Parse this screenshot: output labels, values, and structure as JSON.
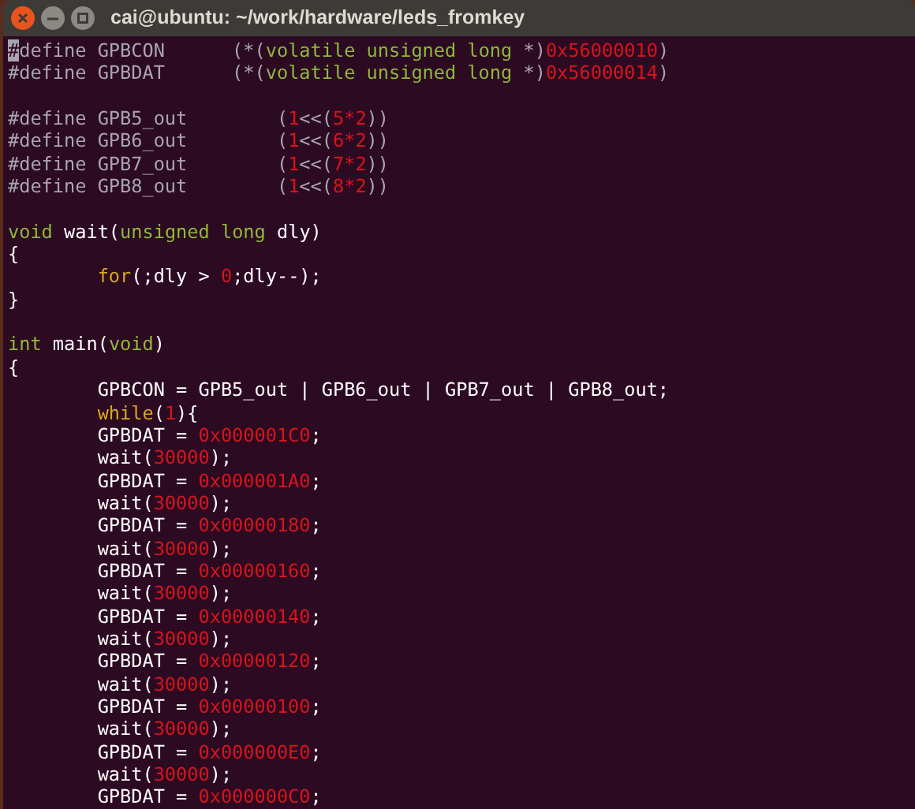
{
  "window": {
    "title": "cai@ubuntu: ~/work/hardware/leds_fromkey"
  },
  "blocks": [
    {
      "lines": [
        {
          "indented": false,
          "segments": [
            {
              "kind": "cursor",
              "text": "#"
            },
            {
              "kind": "preproc",
              "text": "define GPBCON      (*("
            },
            {
              "kind": "type",
              "text": "volatile unsigned long"
            },
            {
              "kind": "preproc",
              "text": " *)"
            },
            {
              "kind": "number",
              "text": "0x56000010"
            },
            {
              "kind": "preproc",
              "text": ")"
            }
          ]
        },
        {
          "indented": false,
          "segments": [
            {
              "kind": "preproc",
              "text": "#define GPBDAT      (*("
            },
            {
              "kind": "type",
              "text": "volatile unsigned long"
            },
            {
              "kind": "preproc",
              "text": " *)"
            },
            {
              "kind": "number",
              "text": "0x56000014"
            },
            {
              "kind": "preproc",
              "text": ")"
            }
          ]
        }
      ]
    },
    {
      "lines": [
        {
          "indented": false,
          "segments": [
            {
              "kind": "preproc",
              "text": "#define GPB5_out        ("
            },
            {
              "kind": "number",
              "text": "1"
            },
            {
              "kind": "preproc",
              "text": "<<("
            },
            {
              "kind": "number",
              "text": "5*2"
            },
            {
              "kind": "preproc",
              "text": "))"
            }
          ]
        },
        {
          "indented": false,
          "segments": [
            {
              "kind": "preproc",
              "text": "#define GPB6_out        ("
            },
            {
              "kind": "number",
              "text": "1"
            },
            {
              "kind": "preproc",
              "text": "<<("
            },
            {
              "kind": "number",
              "text": "6*2"
            },
            {
              "kind": "preproc",
              "text": "))"
            }
          ]
        },
        {
          "indented": false,
          "segments": [
            {
              "kind": "preproc",
              "text": "#define GPB7_out        ("
            },
            {
              "kind": "number",
              "text": "1"
            },
            {
              "kind": "preproc",
              "text": "<<("
            },
            {
              "kind": "number",
              "text": "7*2"
            },
            {
              "kind": "preproc",
              "text": "))"
            }
          ]
        },
        {
          "indented": false,
          "segments": [
            {
              "kind": "preproc",
              "text": "#define GPB8_out        ("
            },
            {
              "kind": "number",
              "text": "1"
            },
            {
              "kind": "preproc",
              "text": "<<("
            },
            {
              "kind": "number",
              "text": "8*2"
            },
            {
              "kind": "preproc",
              "text": "))"
            }
          ]
        }
      ]
    },
    {
      "lines": [
        {
          "indented": false,
          "segments": [
            {
              "kind": "type",
              "text": "void"
            },
            {
              "kind": "plain",
              "text": " wait("
            },
            {
              "kind": "type",
              "text": "unsigned long"
            },
            {
              "kind": "plain",
              "text": " dly)"
            }
          ]
        },
        {
          "indented": false,
          "segments": [
            {
              "kind": "plain",
              "text": "{"
            }
          ]
        },
        {
          "indented": true,
          "segments": [
            {
              "kind": "keyword",
              "text": "for"
            },
            {
              "kind": "plain",
              "text": "(;dly > "
            },
            {
              "kind": "number",
              "text": "0"
            },
            {
              "kind": "plain",
              "text": ";dly--);"
            }
          ]
        },
        {
          "indented": false,
          "segments": [
            {
              "kind": "plain",
              "text": "}"
            }
          ]
        }
      ]
    },
    {
      "lines": [
        {
          "indented": false,
          "segments": [
            {
              "kind": "type",
              "text": "int"
            },
            {
              "kind": "plain",
              "text": " main("
            },
            {
              "kind": "type",
              "text": "void"
            },
            {
              "kind": "plain",
              "text": ")"
            }
          ]
        },
        {
          "indented": false,
          "segments": [
            {
              "kind": "plain",
              "text": "{"
            }
          ]
        },
        {
          "indented": true,
          "segments": [
            {
              "kind": "plain",
              "text": "GPBCON = GPB5_out | GPB6_out | GPB7_out | GPB8_out;"
            }
          ]
        },
        {
          "indented": true,
          "segments": [
            {
              "kind": "keyword",
              "text": "while"
            },
            {
              "kind": "plain",
              "text": "("
            },
            {
              "kind": "number",
              "text": "1"
            },
            {
              "kind": "plain",
              "text": "){"
            }
          ]
        },
        {
          "indented": true,
          "segments": [
            {
              "kind": "plain",
              "text": "GPBDAT = "
            },
            {
              "kind": "number",
              "text": "0x000001C0"
            },
            {
              "kind": "plain",
              "text": ";"
            }
          ]
        },
        {
          "indented": true,
          "segments": [
            {
              "kind": "plain",
              "text": "wait("
            },
            {
              "kind": "number",
              "text": "30000"
            },
            {
              "kind": "plain",
              "text": ");"
            }
          ]
        },
        {
          "indented": true,
          "segments": [
            {
              "kind": "plain",
              "text": "GPBDAT = "
            },
            {
              "kind": "number",
              "text": "0x000001A0"
            },
            {
              "kind": "plain",
              "text": ";"
            }
          ]
        },
        {
          "indented": true,
          "segments": [
            {
              "kind": "plain",
              "text": "wait("
            },
            {
              "kind": "number",
              "text": "30000"
            },
            {
              "kind": "plain",
              "text": ");"
            }
          ]
        },
        {
          "indented": true,
          "segments": [
            {
              "kind": "plain",
              "text": "GPBDAT = "
            },
            {
              "kind": "number",
              "text": "0x00000180"
            },
            {
              "kind": "plain",
              "text": ";"
            }
          ]
        },
        {
          "indented": true,
          "segments": [
            {
              "kind": "plain",
              "text": "wait("
            },
            {
              "kind": "number",
              "text": "30000"
            },
            {
              "kind": "plain",
              "text": ");"
            }
          ]
        },
        {
          "indented": true,
          "segments": [
            {
              "kind": "plain",
              "text": "GPBDAT = "
            },
            {
              "kind": "number",
              "text": "0x00000160"
            },
            {
              "kind": "plain",
              "text": ";"
            }
          ]
        },
        {
          "indented": true,
          "segments": [
            {
              "kind": "plain",
              "text": "wait("
            },
            {
              "kind": "number",
              "text": "30000"
            },
            {
              "kind": "plain",
              "text": ");"
            }
          ]
        },
        {
          "indented": true,
          "segments": [
            {
              "kind": "plain",
              "text": "GPBDAT = "
            },
            {
              "kind": "number",
              "text": "0x00000140"
            },
            {
              "kind": "plain",
              "text": ";"
            }
          ]
        },
        {
          "indented": true,
          "segments": [
            {
              "kind": "plain",
              "text": "wait("
            },
            {
              "kind": "number",
              "text": "30000"
            },
            {
              "kind": "plain",
              "text": ");"
            }
          ]
        },
        {
          "indented": true,
          "segments": [
            {
              "kind": "plain",
              "text": "GPBDAT = "
            },
            {
              "kind": "number",
              "text": "0x00000120"
            },
            {
              "kind": "plain",
              "text": ";"
            }
          ]
        },
        {
          "indented": true,
          "segments": [
            {
              "kind": "plain",
              "text": "wait("
            },
            {
              "kind": "number",
              "text": "30000"
            },
            {
              "kind": "plain",
              "text": ");"
            }
          ]
        },
        {
          "indented": true,
          "segments": [
            {
              "kind": "plain",
              "text": "GPBDAT = "
            },
            {
              "kind": "number",
              "text": "0x00000100"
            },
            {
              "kind": "plain",
              "text": ";"
            }
          ]
        },
        {
          "indented": true,
          "segments": [
            {
              "kind": "plain",
              "text": "wait("
            },
            {
              "kind": "number",
              "text": "30000"
            },
            {
              "kind": "plain",
              "text": ");"
            }
          ]
        },
        {
          "indented": true,
          "segments": [
            {
              "kind": "plain",
              "text": "GPBDAT = "
            },
            {
              "kind": "number",
              "text": "0x000000E0"
            },
            {
              "kind": "plain",
              "text": ";"
            }
          ]
        },
        {
          "indented": true,
          "segments": [
            {
              "kind": "plain",
              "text": "wait("
            },
            {
              "kind": "number",
              "text": "30000"
            },
            {
              "kind": "plain",
              "text": ");"
            }
          ]
        },
        {
          "indented": true,
          "segments": [
            {
              "kind": "plain",
              "text": "GPBDAT = "
            },
            {
              "kind": "number",
              "text": "0x000000C0"
            },
            {
              "kind": "plain",
              "text": ";"
            }
          ]
        }
      ]
    }
  ]
}
